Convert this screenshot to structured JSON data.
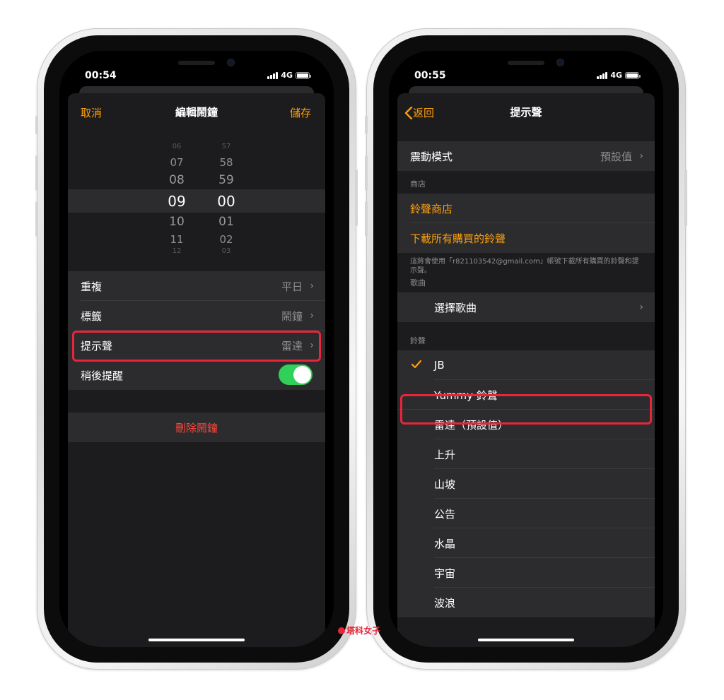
{
  "left_phone": {
    "status": {
      "time": "00:54",
      "network": "4G"
    },
    "nav": {
      "cancel": "取消",
      "title": "編輯鬧鐘",
      "save": "儲存"
    },
    "picker": {
      "hours": [
        "06",
        "07",
        "08",
        "09",
        "10",
        "11",
        "12"
      ],
      "minutes": [
        "57",
        "58",
        "59",
        "00",
        "01",
        "02",
        "03"
      ],
      "selected_hour": "09",
      "selected_minute": "00"
    },
    "settings": [
      {
        "label": "重複",
        "value": "平日"
      },
      {
        "label": "標籤",
        "value": "鬧鐘"
      },
      {
        "label": "提示聲",
        "value": "雷達"
      },
      {
        "label": "稍後提醒",
        "toggle": true
      }
    ],
    "delete_label": "刪除鬧鐘"
  },
  "right_phone": {
    "status": {
      "time": "00:55",
      "network": "4G"
    },
    "nav": {
      "back": "返回",
      "title": "提示聲"
    },
    "vibration": {
      "label": "震動模式",
      "value": "預設值"
    },
    "store_header": "商店",
    "store_items": [
      "鈴聲商店",
      "下載所有購買的鈴聲"
    ],
    "store_note": "這將會使用「r821103542@gmail.com」帳號下載所有購買的鈴聲和提示聲。",
    "songs_header": "歌曲",
    "pick_song": "選擇歌曲",
    "ringtones_header": "鈴聲",
    "ringtones": [
      "JB",
      "Yummy 鈴聲",
      "雷達（預設值）",
      "上升",
      "山坡",
      "公告",
      "水晶",
      "宇宙",
      "波浪"
    ],
    "selected_ringtone": "JB"
  },
  "watermark": "塔科女子",
  "colors": {
    "accent": "#ff9f0a",
    "highlight": "#e8253a",
    "toggle_on": "#30d158",
    "destructive": "#ff453a"
  }
}
